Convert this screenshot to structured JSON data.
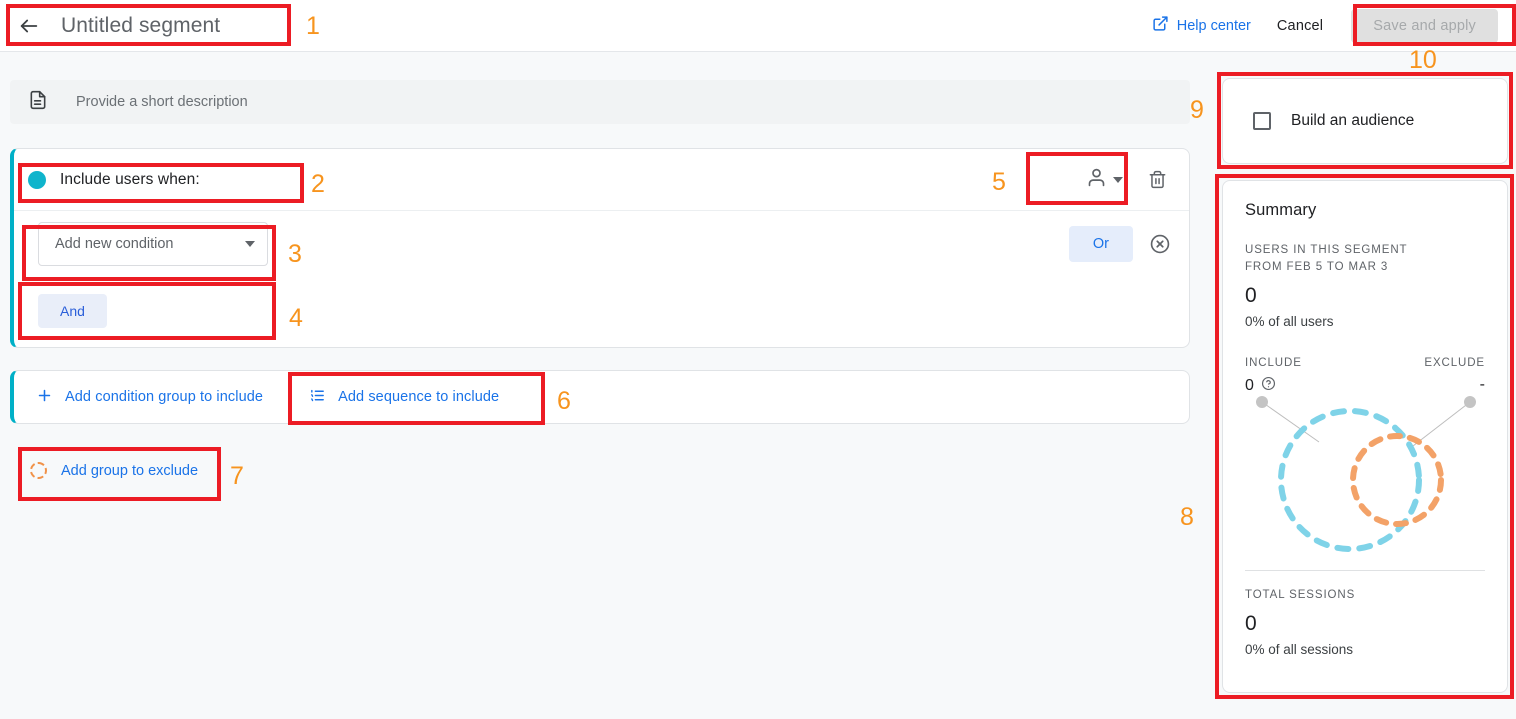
{
  "topbar": {
    "back_icon": "arrow-left-icon",
    "segment_name": "Untitled segment",
    "help_center_label": "Help center",
    "help_center_icon": "open-in-new-icon",
    "cancel_label": "Cancel",
    "save_label": "Save and apply"
  },
  "description": {
    "icon": "document-icon",
    "placeholder": "Provide a short description"
  },
  "include_card": {
    "accent_color": "#00b0c7",
    "scope_dot_color": "#0fb4cc",
    "title": "Include users when:",
    "scope_icon": "person-icon",
    "scope_caret_icon": "chevron-down-icon",
    "delete_icon": "trash-icon",
    "condition_placeholder": "Add new condition",
    "condition_caret_icon": "chevron-down-icon",
    "or_label": "Or",
    "remove_icon": "close-circle-icon",
    "and_label": "And"
  },
  "add_bar": {
    "add_condition_group_label": "Add condition group to include",
    "add_condition_group_icon": "plus-icon",
    "add_sequence_label": "Add sequence to include",
    "add_sequence_icon": "ordered-list-icon"
  },
  "exclude": {
    "label": "Add group to exclude",
    "icon": "dashed-circle-icon",
    "accent_color": "#f19248"
  },
  "audience": {
    "checkbox_icon": "checkbox-unchecked-icon",
    "label": "Build an audience",
    "checked": false
  },
  "summary": {
    "title": "Summary",
    "users_label": "USERS IN THIS SEGMENT FROM FEB 5 TO MAR 3",
    "users_label_line1": "USERS IN THIS SEGMENT",
    "users_label_line2": "FROM FEB 5 TO MAR 3",
    "users_value": "0",
    "users_sub": "0% of all users",
    "include_label": "INCLUDE",
    "include_value": "0",
    "include_help_icon": "help-circle-icon",
    "exclude_label": "EXCLUDE",
    "exclude_value": "-",
    "venn_include_color": "#7fd3e8",
    "venn_exclude_color": "#f3a268",
    "sessions_label": "TOTAL SESSIONS",
    "sessions_value": "0",
    "sessions_sub": "0% of all sessions"
  },
  "annotations": {
    "color": "#ec1c24",
    "number_color": "#f7941e",
    "markers": [
      "1",
      "2",
      "3",
      "4",
      "5",
      "6",
      "7",
      "8",
      "9",
      "10"
    ]
  }
}
